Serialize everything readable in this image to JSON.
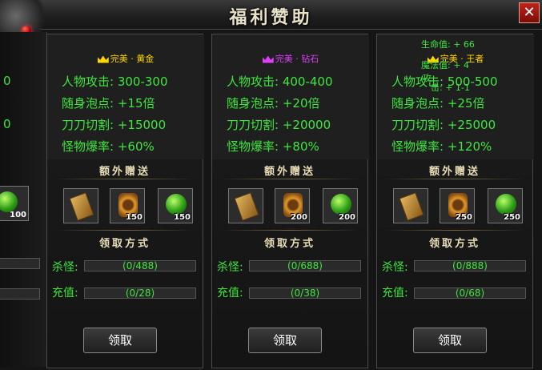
{
  "window": {
    "title": "福利赞助",
    "close_symbol": "✕"
  },
  "partial_left_card": {
    "stat_fragments": [
      "0",
      "0"
    ],
    "slot_count": "100"
  },
  "sections": {
    "extra_gift": "额外赠送",
    "claim_method": "领取方式"
  },
  "labels": {
    "attack": "人物攻击:",
    "bubble": "随身泡点:",
    "cut": "刀刀切割:",
    "drop": "怪物爆率:",
    "kill": "杀怪:",
    "recharge": "充值:"
  },
  "tiers": [
    {
      "quality": "完美",
      "grade": "黄金",
      "crown_color": "#ffd700",
      "attack": "300-300",
      "bubble": "+15倍",
      "cut": "+15000",
      "drop": "+60%",
      "items": [
        {
          "icon": "book-icon",
          "count": ""
        },
        {
          "icon": "medal-icon",
          "count": "150"
        },
        {
          "icon": "orb-icon",
          "count": "150"
        }
      ],
      "kill": "(0/488)",
      "recharge": "(0/28)",
      "button": "领取"
    },
    {
      "quality": "完美",
      "grade": "钻石",
      "crown_color": "#e040fb",
      "attack": "400-400",
      "bubble": "+20倍",
      "cut": "+20000",
      "drop": "+80%",
      "items": [
        {
          "icon": "book-icon",
          "count": ""
        },
        {
          "icon": "medal-icon",
          "count": "200"
        },
        {
          "icon": "orb-icon",
          "count": "200"
        }
      ],
      "kill": "(0/688)",
      "recharge": "(0/38)",
      "button": "领取"
    },
    {
      "quality": "完美",
      "grade": "王者",
      "crown_color": "#ffd700",
      "attack": "500-500",
      "bubble": "+25倍",
      "cut": "+25000",
      "drop": "+120%",
      "items": [
        {
          "icon": "book-icon",
          "count": ""
        },
        {
          "icon": "medal-icon",
          "count": "250"
        },
        {
          "icon": "orb-icon",
          "count": "250"
        }
      ],
      "kill": "(0/888)",
      "recharge": "(0/68)",
      "button": "领取"
    }
  ],
  "tooltip": {
    "line1": "生命值: + 66",
    "line2": "魔法值: + 4",
    "line3": "攻",
    "line4": "击: + 1-1"
  }
}
